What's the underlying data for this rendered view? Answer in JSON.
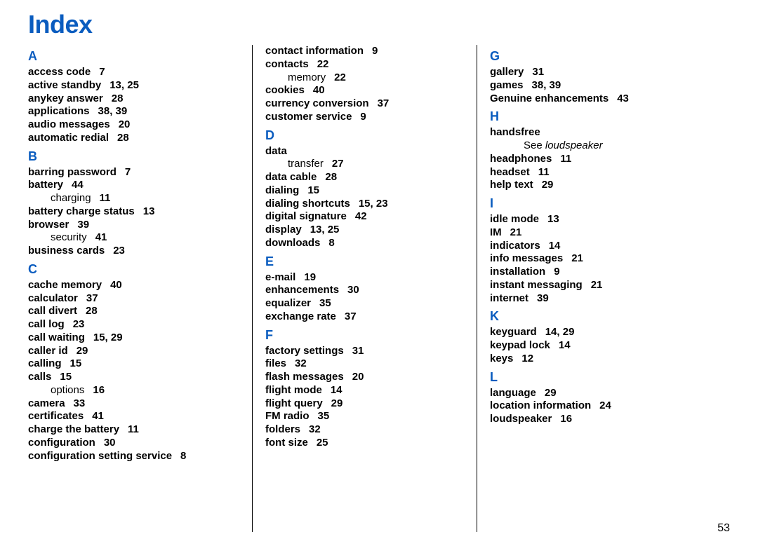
{
  "title": "Index",
  "page_number": "53",
  "columns": [
    [
      {
        "type": "letter",
        "text": "A"
      },
      {
        "type": "entry",
        "term": "access code",
        "pages": "7"
      },
      {
        "type": "entry",
        "term": "active standby",
        "pages": "13, 25"
      },
      {
        "type": "entry",
        "term": "anykey answer",
        "pages": "28"
      },
      {
        "type": "entry",
        "term": "applications",
        "pages": "38, 39"
      },
      {
        "type": "entry",
        "term": "audio messages",
        "pages": "20"
      },
      {
        "type": "entry",
        "term": "automatic redial",
        "pages": "28"
      },
      {
        "type": "letter",
        "text": "B"
      },
      {
        "type": "entry",
        "term": "barring password",
        "pages": "7"
      },
      {
        "type": "entry",
        "term": "battery",
        "pages": "44"
      },
      {
        "type": "sub",
        "term": "charging",
        "pages": "11"
      },
      {
        "type": "entry",
        "term": "battery charge status",
        "pages": "13"
      },
      {
        "type": "entry",
        "term": "browser",
        "pages": "39"
      },
      {
        "type": "sub",
        "term": "security",
        "pages": "41"
      },
      {
        "type": "entry",
        "term": "business cards",
        "pages": "23"
      },
      {
        "type": "letter",
        "text": "C"
      },
      {
        "type": "entry",
        "term": "cache memory",
        "pages": "40"
      },
      {
        "type": "entry",
        "term": "calculator",
        "pages": "37"
      },
      {
        "type": "entry",
        "term": "call divert",
        "pages": "28"
      },
      {
        "type": "entry",
        "term": "call log",
        "pages": "23"
      },
      {
        "type": "entry",
        "term": "call waiting",
        "pages": "15, 29"
      },
      {
        "type": "entry",
        "term": "caller id",
        "pages": "29"
      },
      {
        "type": "entry",
        "term": "calling",
        "pages": "15"
      },
      {
        "type": "entry",
        "term": "calls",
        "pages": "15"
      },
      {
        "type": "sub",
        "term": "options",
        "pages": "16"
      },
      {
        "type": "entry",
        "term": "camera",
        "pages": "33"
      },
      {
        "type": "entry",
        "term": "certificates",
        "pages": "41"
      },
      {
        "type": "entry",
        "term": "charge the battery",
        "pages": "11"
      },
      {
        "type": "entry",
        "term": "configuration",
        "pages": "30"
      },
      {
        "type": "entry",
        "term": "configuration setting service",
        "pages": "8"
      }
    ],
    [
      {
        "type": "entry",
        "term": "contact information",
        "pages": "9"
      },
      {
        "type": "entry",
        "term": "contacts",
        "pages": "22"
      },
      {
        "type": "sub",
        "term": "memory",
        "pages": "22"
      },
      {
        "type": "entry",
        "term": "cookies",
        "pages": "40"
      },
      {
        "type": "entry",
        "term": "currency conversion",
        "pages": "37"
      },
      {
        "type": "entry",
        "term": "customer service",
        "pages": "9"
      },
      {
        "type": "letter",
        "text": "D"
      },
      {
        "type": "entry",
        "term": "data",
        "pages": ""
      },
      {
        "type": "sub",
        "term": "transfer",
        "pages": "27"
      },
      {
        "type": "entry",
        "term": "data cable",
        "pages": "28"
      },
      {
        "type": "entry",
        "term": "dialing",
        "pages": "15"
      },
      {
        "type": "entry",
        "term": "dialing shortcuts",
        "pages": "15, 23"
      },
      {
        "type": "entry",
        "term": "digital signature",
        "pages": "42"
      },
      {
        "type": "entry",
        "term": "display",
        "pages": "13, 25"
      },
      {
        "type": "entry",
        "term": "downloads",
        "pages": "8"
      },
      {
        "type": "letter",
        "text": "E"
      },
      {
        "type": "entry",
        "term": "e-mail",
        "pages": "19"
      },
      {
        "type": "entry",
        "term": "enhancements",
        "pages": "30"
      },
      {
        "type": "entry",
        "term": "equalizer",
        "pages": "35"
      },
      {
        "type": "entry",
        "term": "exchange rate",
        "pages": "37"
      },
      {
        "type": "letter",
        "text": "F"
      },
      {
        "type": "entry",
        "term": "factory settings",
        "pages": "31"
      },
      {
        "type": "entry",
        "term": "files",
        "pages": "32"
      },
      {
        "type": "entry",
        "term": "flash messages",
        "pages": "20"
      },
      {
        "type": "entry",
        "term": "flight mode",
        "pages": "14"
      },
      {
        "type": "entry",
        "term": "flight query",
        "pages": "29"
      },
      {
        "type": "entry",
        "term": "FM radio",
        "pages": "35"
      },
      {
        "type": "entry",
        "term": "folders",
        "pages": "32"
      },
      {
        "type": "entry",
        "term": "font size",
        "pages": "25"
      }
    ],
    [
      {
        "type": "letter",
        "text": "G"
      },
      {
        "type": "entry",
        "term": "gallery",
        "pages": "31"
      },
      {
        "type": "entry",
        "term": "games",
        "pages": "38, 39"
      },
      {
        "type": "entry",
        "term": "Genuine enhancements",
        "pages": "43"
      },
      {
        "type": "letter",
        "text": "H"
      },
      {
        "type": "entry",
        "term": "handsfree",
        "pages": ""
      },
      {
        "type": "see",
        "prefix": "See ",
        "target": "loudspeaker"
      },
      {
        "type": "entry",
        "term": "headphones",
        "pages": "11"
      },
      {
        "type": "entry",
        "term": "headset",
        "pages": "11"
      },
      {
        "type": "entry",
        "term": "help text",
        "pages": "29"
      },
      {
        "type": "letter",
        "text": "I"
      },
      {
        "type": "entry",
        "term": "idle mode",
        "pages": "13"
      },
      {
        "type": "entry",
        "term": "IM",
        "pages": "21"
      },
      {
        "type": "entry",
        "term": "indicators",
        "pages": "14"
      },
      {
        "type": "entry",
        "term": "info messages",
        "pages": "21"
      },
      {
        "type": "entry",
        "term": "installation",
        "pages": "9"
      },
      {
        "type": "entry",
        "term": "instant messaging",
        "pages": "21"
      },
      {
        "type": "entry",
        "term": "internet",
        "pages": "39"
      },
      {
        "type": "letter",
        "text": "K"
      },
      {
        "type": "entry",
        "term": "keyguard",
        "pages": "14, 29"
      },
      {
        "type": "entry",
        "term": "keypad lock",
        "pages": "14"
      },
      {
        "type": "entry",
        "term": "keys",
        "pages": "12"
      },
      {
        "type": "letter",
        "text": "L"
      },
      {
        "type": "entry",
        "term": "language",
        "pages": "29"
      },
      {
        "type": "entry",
        "term": "location information",
        "pages": "24"
      },
      {
        "type": "entry",
        "term": "loudspeaker",
        "pages": "16"
      }
    ]
  ]
}
